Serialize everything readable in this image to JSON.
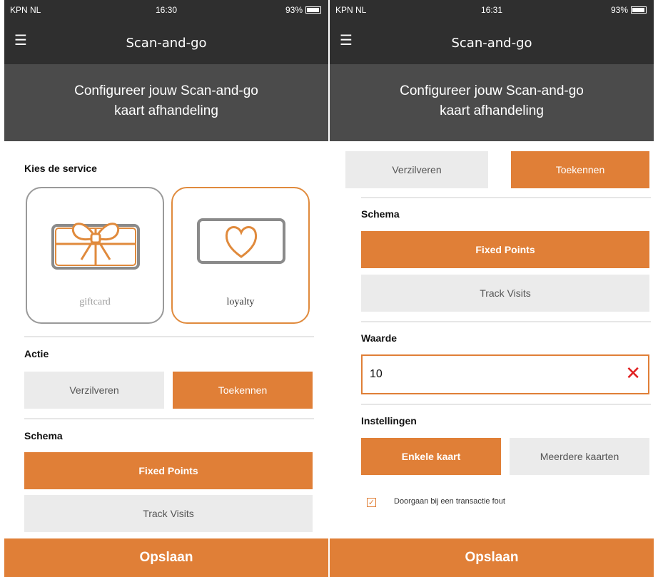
{
  "status": {
    "carrier_left": "KPN NL",
    "time_left": "16:30",
    "carrier_right": "KPN NL",
    "time_right": "16:31",
    "battery": "93%"
  },
  "app": {
    "title": "Scan-and-go",
    "menu_icon": "hamburger-menu-icon"
  },
  "banner": {
    "line1": "Configureer jouw Scan-and-go",
    "line2": "kaart afhandeling"
  },
  "service": {
    "label": "Kies de service",
    "options": [
      {
        "label": "giftcard",
        "icon": "gift-card-icon",
        "selected": false
      },
      {
        "label": "loyalty",
        "icon": "heart-card-icon",
        "selected": true
      }
    ]
  },
  "action": {
    "label": "Actie",
    "options": [
      "Verzilveren",
      "Toekennen"
    ],
    "selected": "Toekennen"
  },
  "schema": {
    "label": "Schema",
    "options": [
      "Fixed Points",
      "Track Visits"
    ],
    "selected": "Fixed Points"
  },
  "value": {
    "label": "Waarde",
    "current": "10",
    "clear_icon": "close-icon"
  },
  "settings": {
    "label": "Instellingen",
    "options": [
      "Enkele kaart",
      "Meerdere kaarten"
    ],
    "selected": "Enkele kaart"
  },
  "continue_on_error": {
    "label": "Doorgaan bij een transactie fout",
    "checked": true
  },
  "save_label": "Opslaan",
  "colors": {
    "accent": "#e07f37",
    "header": "#2f2f2f",
    "banner": "#4b4b4b",
    "segment_off": "#ebebeb"
  }
}
